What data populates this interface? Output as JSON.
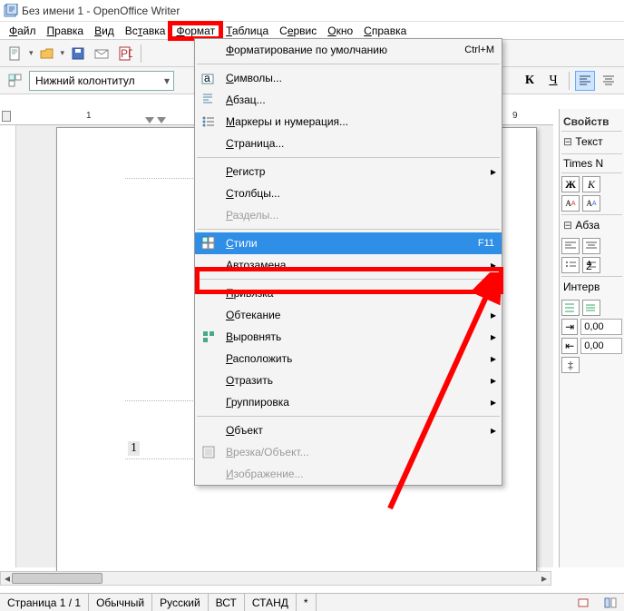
{
  "title": "Без имени 1 - OpenOffice Writer",
  "menubar": [
    "Файл",
    "Правка",
    "Вид",
    "Вставка",
    "Формат",
    "Таблица",
    "Сервис",
    "Окно",
    "Справка"
  ],
  "menubar_underline_index": [
    0,
    0,
    0,
    2,
    0,
    0,
    1,
    0,
    0
  ],
  "style_select": "Нижний колонтитул",
  "ruler": {
    "label_left": "9",
    "label_left2": "1",
    "label_right": "9"
  },
  "page": {
    "page_number": "1"
  },
  "status": {
    "page": "Страница 1 / 1",
    "style": "Обычный",
    "lang": "Русский",
    "ins": "ВСТ",
    "sel": "СТАНД",
    "mod": "*"
  },
  "side": {
    "title": "Свойств",
    "text_section": "Текст",
    "font": "Times N",
    "bold": "Ж",
    "italic": "К",
    "para_section": "Абза",
    "spacing_section": "Интерв",
    "spin1": "0,00",
    "spin2": "0,00"
  },
  "dropdown": [
    {
      "label": "Форматирование по умолчанию",
      "shortcut": "Ctrl+M",
      "icon": "",
      "type": "item"
    },
    {
      "type": "sep"
    },
    {
      "label": "Символы...",
      "icon": "char",
      "type": "item"
    },
    {
      "label": "Абзац...",
      "icon": "para",
      "type": "item"
    },
    {
      "label": "Маркеры и нумерация...",
      "icon": "list",
      "type": "item"
    },
    {
      "label": "Страница...",
      "icon": "",
      "type": "item"
    },
    {
      "type": "sep"
    },
    {
      "label": "Регистр",
      "type": "sub"
    },
    {
      "label": "Столбцы...",
      "type": "item"
    },
    {
      "label": "Разделы...",
      "type": "item",
      "disabled": true
    },
    {
      "type": "sep"
    },
    {
      "label": "Стили",
      "shortcut": "F11",
      "icon": "styles",
      "type": "item",
      "highlight": true
    },
    {
      "label": "Автозамена",
      "type": "sub"
    },
    {
      "type": "sep"
    },
    {
      "label": "Привязка",
      "type": "sub"
    },
    {
      "label": "Обтекание",
      "type": "sub"
    },
    {
      "label": "Выровнять",
      "icon": "align",
      "type": "sub"
    },
    {
      "label": "Расположить",
      "type": "sub"
    },
    {
      "label": "Отразить",
      "type": "sub"
    },
    {
      "label": "Группировка",
      "type": "sub"
    },
    {
      "type": "sep"
    },
    {
      "label": "Объект",
      "type": "sub"
    },
    {
      "label": "Врезка/Объект...",
      "icon": "frame",
      "type": "item",
      "disabled": true
    },
    {
      "label": "Изображение...",
      "type": "item",
      "disabled": true
    }
  ]
}
